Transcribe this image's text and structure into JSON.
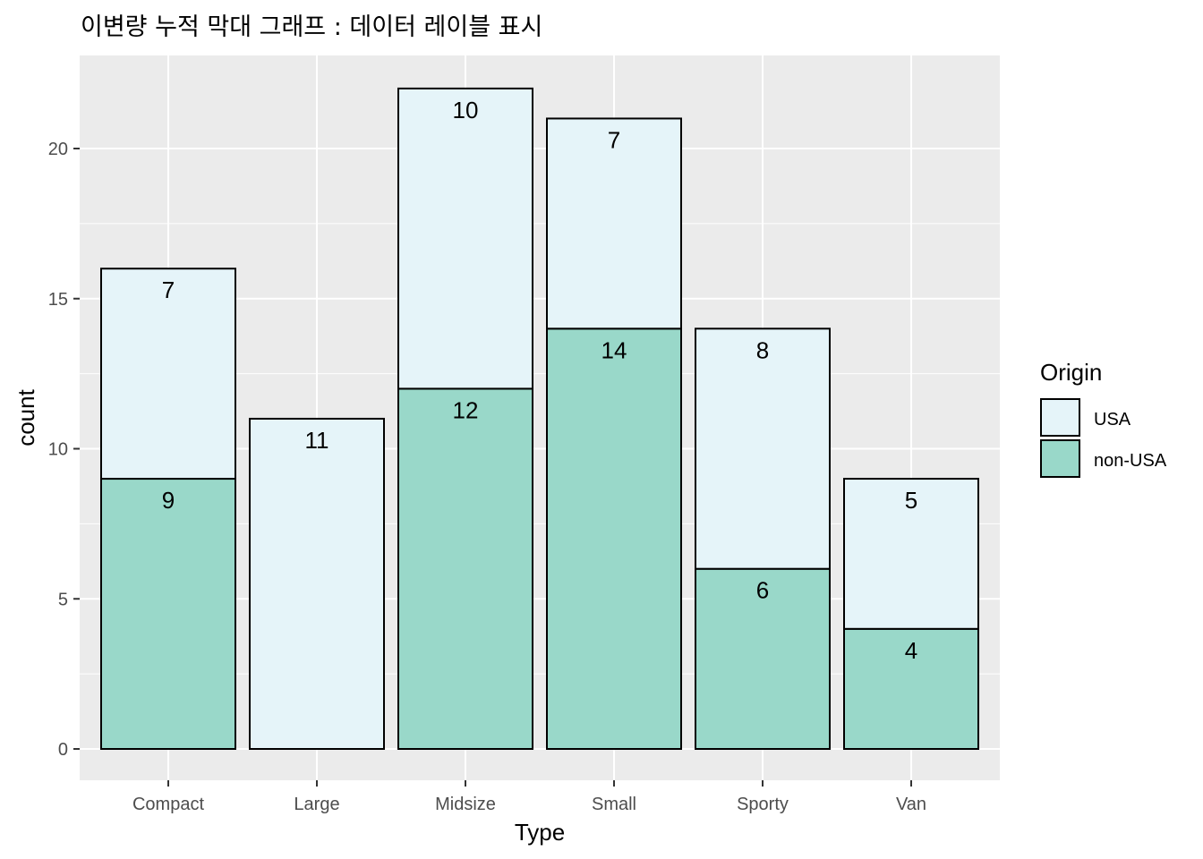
{
  "chart_data": {
    "type": "bar",
    "stacked": true,
    "title": "이변량 누적 막대 그래프 : 데이터 레이블 표시",
    "xlabel": "Type",
    "ylabel": "count",
    "categories": [
      "Compact",
      "Large",
      "Midsize",
      "Small",
      "Sporty",
      "Van"
    ],
    "series": [
      {
        "name": "USA",
        "color": "#E5F4F9",
        "values": [
          7,
          11,
          10,
          7,
          8,
          5
        ]
      },
      {
        "name": "non-USA",
        "color": "#99D8C9",
        "values": [
          9,
          0,
          12,
          14,
          6,
          4
        ]
      }
    ],
    "stack_order_bottom_to_top": [
      "non-USA",
      "USA"
    ],
    "ylim": [
      0,
      22
    ],
    "yticks": [
      0,
      5,
      10,
      15,
      20
    ],
    "ytick_labels": [
      "0",
      "5",
      "10",
      "15",
      "20"
    ],
    "grid": true,
    "panel_background": "#EBEBEB",
    "bar_outline": "#000000",
    "legend": {
      "title": "Origin",
      "position": "right",
      "entries": [
        "USA",
        "non-USA"
      ]
    },
    "data_labels": true
  }
}
